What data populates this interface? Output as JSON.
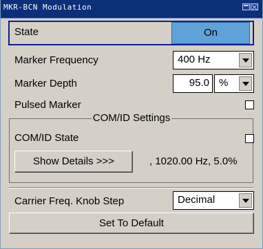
{
  "window": {
    "title": "MKR-BCN Modulation"
  },
  "state": {
    "label": "State",
    "value": "On"
  },
  "marker_frequency": {
    "label": "Marker Frequency",
    "value": "400 Hz"
  },
  "marker_depth": {
    "label": "Marker Depth",
    "value": "95.0",
    "unit": "%"
  },
  "pulsed_marker": {
    "label": "Pulsed Marker",
    "checked": false
  },
  "comid": {
    "group_title": "COM/ID Settings",
    "state_label": "COM/ID State",
    "state_checked": false,
    "show_details_label": "Show Details >>>",
    "summary": ", 1020.00 Hz, 5.0%"
  },
  "carrier_knob": {
    "label": "Carrier Freq. Knob Step",
    "value": "Decimal"
  },
  "default_button": {
    "label": "Set To Default"
  }
}
